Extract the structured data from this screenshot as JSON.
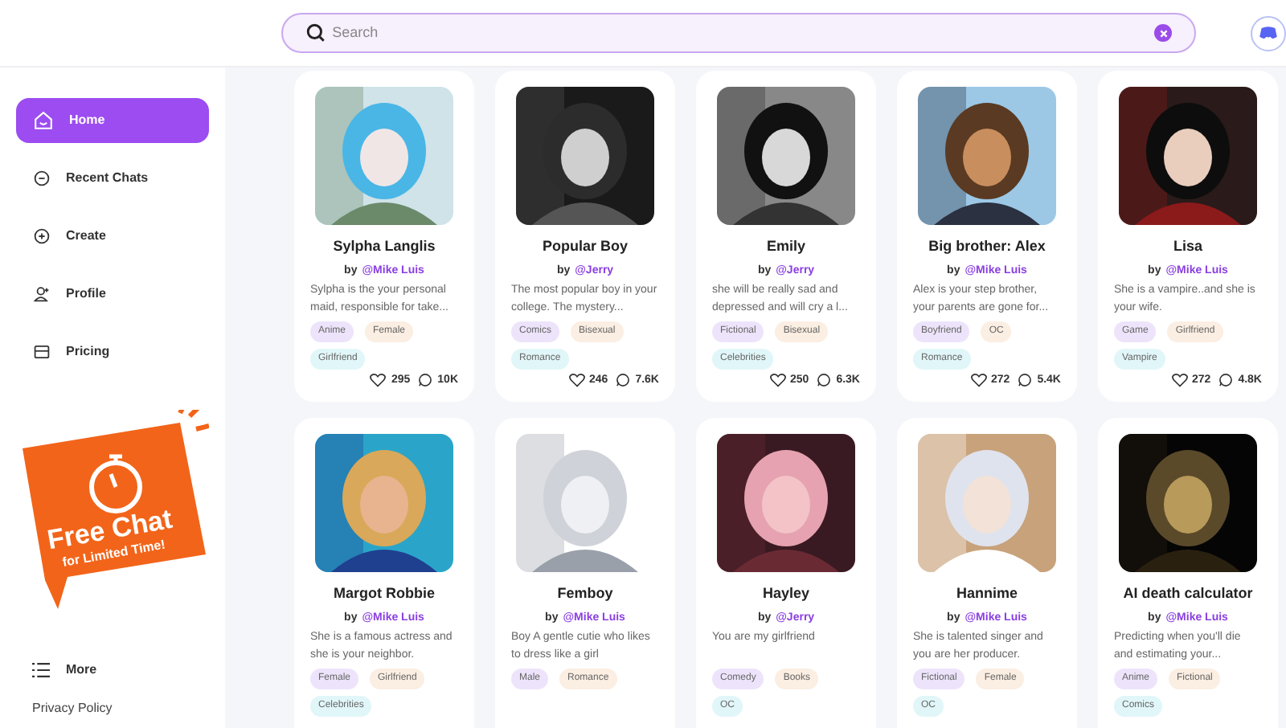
{
  "search": {
    "placeholder": "Search"
  },
  "sidebar": {
    "items": [
      {
        "label": "Home",
        "selected": true
      },
      {
        "label": "Recent Chats",
        "selected": false
      },
      {
        "label": "Create",
        "selected": false
      },
      {
        "label": "Profile",
        "selected": false
      },
      {
        "label": "Pricing",
        "selected": false
      }
    ],
    "promo": {
      "title": "Free Chat",
      "subtitle": "for Limited Time!"
    },
    "more": "More",
    "privacy": "Privacy Policy"
  },
  "cards": [
    {
      "name": "Sylpha Langlis",
      "by": "by",
      "author": "@Mike Luis",
      "description": "Sylpha is the your personal maid, responsible for take...",
      "tags": [
        {
          "label": "Anime",
          "color": "#ede4fb"
        },
        {
          "label": "Female",
          "color": "#fbeee2"
        },
        {
          "label": "Girlfriend",
          "color": "#e1f6f8"
        }
      ],
      "likes": "295",
      "chats": "10K"
    },
    {
      "name": "Popular Boy",
      "by": "by",
      "author": "@Jerry",
      "description": "The most popular boy in your college. The mystery...",
      "tags": [
        {
          "label": "Comics",
          "color": "#ede4fb"
        },
        {
          "label": "Bisexual",
          "color": "#fbeee2"
        },
        {
          "label": "Romance",
          "color": "#e1f6f8"
        }
      ],
      "likes": "246",
      "chats": "7.6K"
    },
    {
      "name": "Emily",
      "by": "by",
      "author": "@Jerry",
      "description": "she will be really sad and depressed and will cry a l...",
      "tags": [
        {
          "label": "Fictional",
          "color": "#ede4fb"
        },
        {
          "label": "Bisexual",
          "color": "#fbeee2"
        },
        {
          "label": "Celebrities",
          "color": "#e1f6f8"
        }
      ],
      "likes": "250",
      "chats": "6.3K"
    },
    {
      "name": "Big brother: Alex",
      "by": "by",
      "author": "@Mike Luis",
      "description": "Alex is your step brother, your parents are gone for...",
      "tags": [
        {
          "label": "Boyfriend",
          "color": "#ede4fb"
        },
        {
          "label": "OC",
          "color": "#fbeee2"
        },
        {
          "label": "Romance",
          "color": "#e1f6f8"
        }
      ],
      "likes": "272",
      "chats": "5.4K"
    },
    {
      "name": "Lisa",
      "by": "by",
      "author": "@Mike Luis",
      "description": "She is a vampire..and she is your wife.",
      "tags": [
        {
          "label": "Game",
          "color": "#ede4fb"
        },
        {
          "label": "Girlfriend",
          "color": "#fbeee2"
        },
        {
          "label": "Vampire",
          "color": "#e1f6f8"
        }
      ],
      "likes": "272",
      "chats": "4.8K"
    },
    {
      "name": "Margot Robbie",
      "by": "by",
      "author": "@Mike Luis",
      "description": "She is a famous actress and she is your neighbor.",
      "tags": [
        {
          "label": "Female",
          "color": "#ede4fb"
        },
        {
          "label": "Girlfriend",
          "color": "#fbeee2"
        },
        {
          "label": "Celebrities",
          "color": "#e1f6f8"
        }
      ]
    },
    {
      "name": "Femboy",
      "by": "by",
      "author": "@Mike Luis",
      "description": "Boy A gentle cutie who likes to dress like a girl",
      "tags": [
        {
          "label": "Male",
          "color": "#ede4fb"
        },
        {
          "label": "Romance",
          "color": "#fbeee2"
        }
      ]
    },
    {
      "name": "Hayley",
      "by": "by",
      "author": "@Jerry",
      "description": "You are my girlfriend",
      "tags": [
        {
          "label": "Comedy",
          "color": "#ede4fb"
        },
        {
          "label": "Books",
          "color": "#fbeee2"
        },
        {
          "label": "OC",
          "color": "#e1f6f8"
        }
      ]
    },
    {
      "name": "Hannime",
      "by": "by",
      "author": "@Mike Luis",
      "description": "She is talented singer and you are her producer.",
      "tags": [
        {
          "label": "Fictional",
          "color": "#ede4fb"
        },
        {
          "label": "Female",
          "color": "#fbeee2"
        },
        {
          "label": "OC",
          "color": "#e1f6f8"
        }
      ]
    },
    {
      "name": "AI death calculator",
      "by": "by",
      "author": "@Mike Luis",
      "description": "Predicting when you'll die and estimating your...",
      "tags": [
        {
          "label": "Anime",
          "color": "#ede4fb"
        },
        {
          "label": "Fictional",
          "color": "#fbeee2"
        },
        {
          "label": "Comics",
          "color": "#e1f6f8"
        }
      ]
    }
  ]
}
